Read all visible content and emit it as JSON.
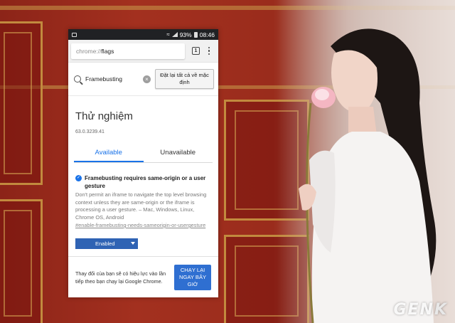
{
  "status_bar": {
    "battery": "93%",
    "time": "08:46"
  },
  "toolbar": {
    "url_scheme": "chrome://",
    "url_host": "flags",
    "tab_count": "1"
  },
  "search": {
    "query": "Framebusting",
    "reset_label": "Đặt lại tất cả về mặc định"
  },
  "page": {
    "title": "Thử nghiệm",
    "version": "63.0.3239.41"
  },
  "tabs": [
    {
      "label": "Available"
    },
    {
      "label": "Unavailable"
    }
  ],
  "flag": {
    "name": "Framebusting requires same-origin or a user gesture",
    "description": "Don't permit an iframe to navigate the top level browsing context unless they are same-origin or the iframe is processing a user gesture. – Mac, Windows, Linux, Chrome OS, Android",
    "link": "#enable-framebusting-needs-sameorigin-or-usergesture",
    "state": "Enabled"
  },
  "relaunch": {
    "message": "Thay đổi của bạn sẽ có hiệu lực vào lần tiếp theo bạn chạy lại Google Chrome.",
    "button_label": "CHẠY LẠI NGAY BÂY GIỜ"
  },
  "watermark": {
    "text": "GEN",
    "text_k": "K"
  }
}
